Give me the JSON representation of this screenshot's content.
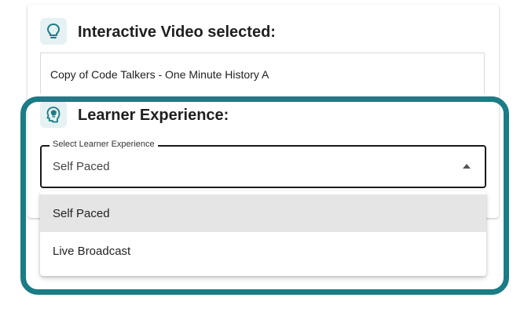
{
  "video_section": {
    "title": "Interactive Video selected:",
    "icon": "lightbulb-icon",
    "video_name": "Copy of Code Talkers - One Minute History A"
  },
  "learner_section": {
    "title": "Learner Experience:",
    "icon": "lightbulb-head-icon"
  },
  "select": {
    "label": "Select Learner Experience",
    "value": "Self Paced",
    "options": [
      {
        "label": "Self Paced",
        "selected": true
      },
      {
        "label": "Live Broadcast",
        "selected": false
      }
    ]
  },
  "colors": {
    "accent": "#1b7c85",
    "icon_bg": "#e6f1f3",
    "selected_option_bg": "#e5e5e5"
  }
}
